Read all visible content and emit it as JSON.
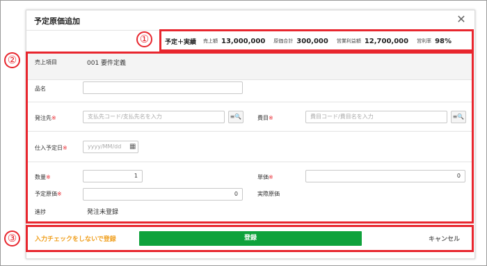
{
  "dialog": {
    "title": "予定原価追加",
    "close_icon": "close-icon"
  },
  "markers": [
    "①",
    "②",
    "③"
  ],
  "summary": {
    "title": "予定＋実績",
    "items": [
      {
        "label": "売上額",
        "value": "13,000,000"
      },
      {
        "label": "原価合計",
        "value": "300,000"
      },
      {
        "label": "営業利益額",
        "value": "12,700,000"
      },
      {
        "label": "営利率",
        "value": "98%"
      }
    ]
  },
  "form": {
    "sales_item": {
      "label": "売上項目",
      "value": "001 要件定義"
    },
    "item_name": {
      "label": "品名",
      "value": ""
    },
    "supplier": {
      "label": "発注先",
      "required_mark": "※",
      "placeholder": "支払先コード/支払先名を入力",
      "button_icon": "≡🔍"
    },
    "expense": {
      "label": "費目",
      "required_mark": "※",
      "placeholder": "費目コード/費目名を入力",
      "button_icon": "≡🔍"
    },
    "purchase_date": {
      "label": "仕入予定日",
      "required_mark": "※",
      "placeholder": "yyyy/MM/dd",
      "icon": "calendar-icon"
    },
    "quantity": {
      "label": "数量",
      "required_mark": "※",
      "value": "1"
    },
    "unit_price": {
      "label": "単価",
      "required_mark": "※",
      "value": "0"
    },
    "planned_cost": {
      "label": "予定原価",
      "required_mark": "※",
      "value": "0"
    },
    "actual_cost": {
      "label": "実際原価",
      "value": ""
    },
    "progress": {
      "label": "進捗",
      "value": "発注未登録"
    }
  },
  "footer": {
    "register_without_check": "入力チェックをしないで登録",
    "register": "登録",
    "cancel": "キャンセル"
  },
  "colors": {
    "highlight": "#e8262e",
    "primary": "#0fa23c",
    "link": "#f0a020"
  }
}
